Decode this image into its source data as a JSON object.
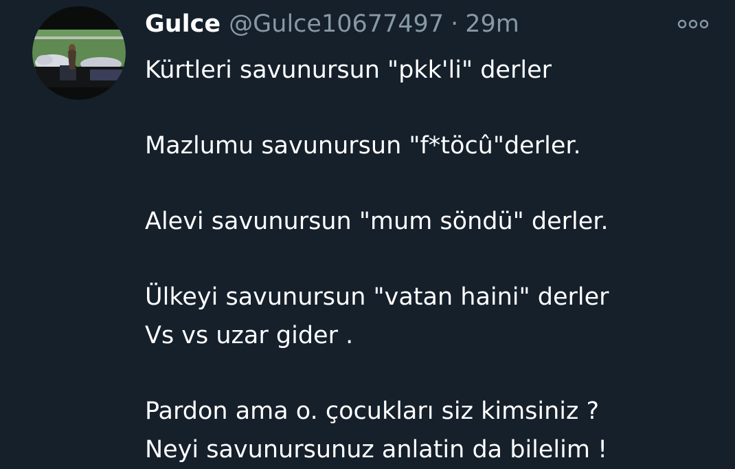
{
  "tweet": {
    "display_name": "Gulce",
    "handle": "@Gulce10677497",
    "separator": "·",
    "time": "29m",
    "avatar_icon": "profile-photo",
    "more_icon": "more-options-icon",
    "lines": [
      "Kürtleri savunursun \"pkk'li\" derler",
      "Mazlumu savunursun \"f*töcû\"derler.",
      "Alevi savunursun \"mum söndü\" derler.",
      "Ülkeyi savunursun \"vatan haini\" derler",
      "Vs vs uzar gider .",
      "Pardon ama o. çocukları siz kimsiniz ?",
      "Neyi savunursunuz anlatin da bilelim !"
    ]
  },
  "colors": {
    "background": "#15202b",
    "text": "#ffffff",
    "secondary_text": "#8899a6"
  }
}
